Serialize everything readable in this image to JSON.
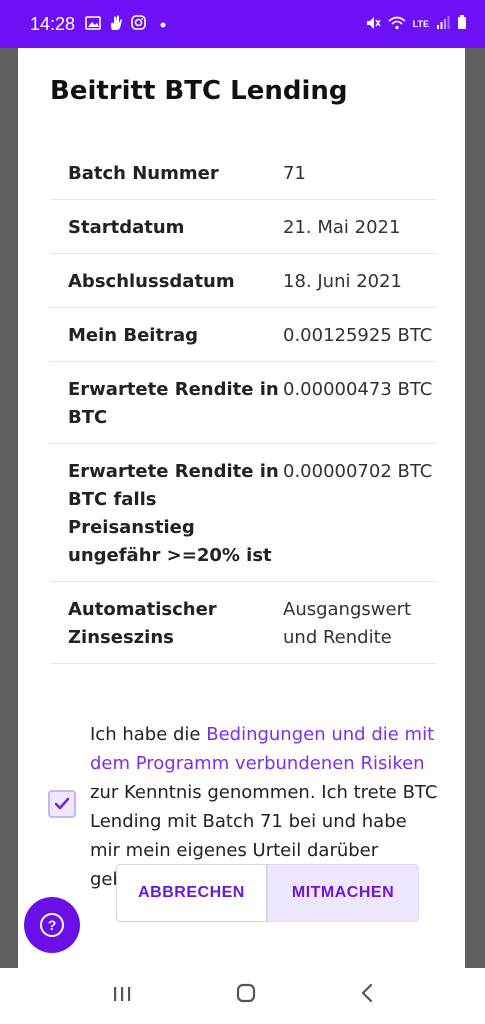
{
  "status_bar": {
    "time": "14:28",
    "lte": "LTE",
    "battery_icon": "battery-icon",
    "icons_left": [
      "image-icon",
      "hand-icon",
      "instagram-icon",
      "dot-icon"
    ],
    "icons_right": [
      "mute-icon",
      "wifi-icon",
      "lte-icon",
      "signal-icon",
      "battery-icon"
    ]
  },
  "dialog": {
    "title": "Beitritt BTC Lending",
    "rows": [
      {
        "label": "Batch Nummer",
        "value": "71"
      },
      {
        "label": "Startdatum",
        "value": "21. Mai 2021"
      },
      {
        "label": "Abschlussdatum",
        "value": "18. Juni 2021"
      },
      {
        "label": "Mein Beitrag",
        "value": "0.00125925 BTC"
      },
      {
        "label": "Erwartete Rendite in BTC",
        "value": "0.00000473 BTC"
      },
      {
        "label": "Erwartete Rendite in BTC falls Preisanstieg ungefähr >=20% ist",
        "value": "0.00000702 BTC"
      },
      {
        "label": "Automatischer Zinseszins",
        "value": "Ausgangswert und Rendite"
      }
    ],
    "consent": {
      "checked": true,
      "text_before": "Ich habe die ",
      "link": "Bedingungen und die mit dem Programm verbundenen Risiken",
      "text_after": " zur Kenntnis genommen. Ich trete BTC Lending mit Batch 71 bei und habe mir mein eigenes Urteil darüber gebildet."
    },
    "buttons": {
      "cancel": "ABBRECHEN",
      "join": "MITMACHEN"
    }
  },
  "help_fab": {
    "icon": "help-icon",
    "glyph": "?"
  },
  "nav": {
    "recents_icon": "recents-icon",
    "home_icon": "home-icon",
    "back_icon": "back-icon"
  },
  "colors": {
    "accent": "#6c11f5",
    "link": "#7b2ff2",
    "button_text": "#6a1ad6"
  }
}
